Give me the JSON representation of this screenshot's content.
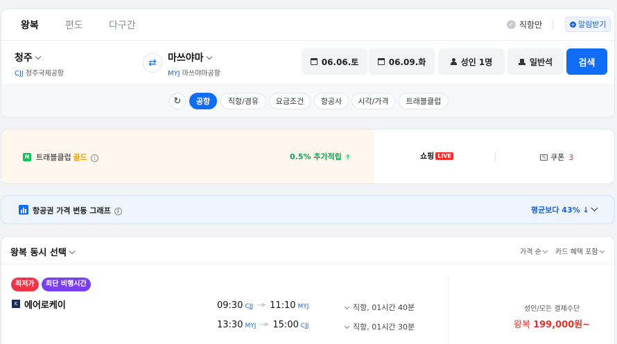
{
  "trip_tabs": [
    "왕복",
    "편도",
    "다구간"
  ],
  "direct_only_label": "직항만",
  "alert_label": "알림받기",
  "origin": {
    "name": "청주",
    "code": "CJJ",
    "airport": "청주국제공항"
  },
  "destination": {
    "name": "마쓰야마",
    "code": "MYJ",
    "airport": "마쓰야마공항"
  },
  "depart_date": "06.06.토",
  "return_date": "06.09.화",
  "passengers": "성인 1명",
  "cabin": "일반석",
  "search_label": "검색",
  "filters": [
    "공항",
    "직항/경유",
    "요금조건",
    "항공사",
    "시각/가격",
    "트래블클럽"
  ],
  "promo": {
    "travel_club_label": "트래블클럽",
    "tier": "골드",
    "accrual": "0.5% 추가적립",
    "shopping_label": "쇼핑",
    "live_label": "LIVE",
    "coupon_label": "쿠폰",
    "coupon_count": "3"
  },
  "price_graph": {
    "label": "항공권 가격 변동 그래프",
    "value": "평균보다 43% ↓"
  },
  "results": {
    "title": "왕복 동시 선택",
    "sort_label": "가격 순",
    "card_benefit_label": "카드 혜택 포함",
    "flights": [
      {
        "badges": [
          "최저가",
          "최단 비행시간"
        ],
        "airline": "에어로케이",
        "airline_logo": "K",
        "legs": [
          {
            "depart": "09:30",
            "from": "CJJ",
            "arrive": "11:10",
            "to": "MYJ",
            "info": "직항, 01시간 40분"
          },
          {
            "depart": "13:30",
            "from": "MYJ",
            "arrive": "15:00",
            "to": "CJJ",
            "info": "직항, 01시간 30분"
          }
        ],
        "fare_caption": "성인/모든 결제수단",
        "fare_prefix": "왕복",
        "fare_amount": "199,000원~"
      }
    ]
  },
  "colors": {
    "primary": "#0f6df7",
    "accent_red": "#e0332c",
    "green": "#12a150",
    "gold": "#e8a400",
    "purple": "#7b3ff2"
  }
}
